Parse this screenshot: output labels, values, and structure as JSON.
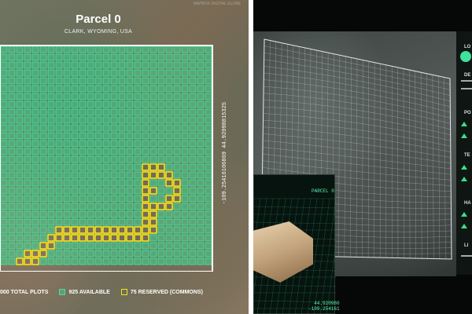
{
  "map": {
    "title": "Parcel 0",
    "subtitle": "CLARK, WYOMING, USA",
    "corner_text": "MAPBOX DIGITAL GLOBE",
    "coordinate_vertical": "-109.25416106869 44.92098815325",
    "grid": {
      "cols": 27,
      "rows": 28,
      "color_available": "#3fe29b",
      "color_reserved": "#f3e41c",
      "fill_available": "rgba(63,226,155,0.5)"
    }
  },
  "legend": {
    "total": "000 TOTAL PLOTS",
    "available": "925 AVAILABLE",
    "reserved": "75 RESERVED (COMMONS)"
  },
  "viewer": {
    "panel_title": "PARCEL 0",
    "coord_lat": "44.920980",
    "coord_lon": "-109.254161"
  },
  "sidebar": {
    "labels": [
      "LO",
      "DE",
      "PO",
      "TE",
      "HA",
      "LI"
    ]
  }
}
